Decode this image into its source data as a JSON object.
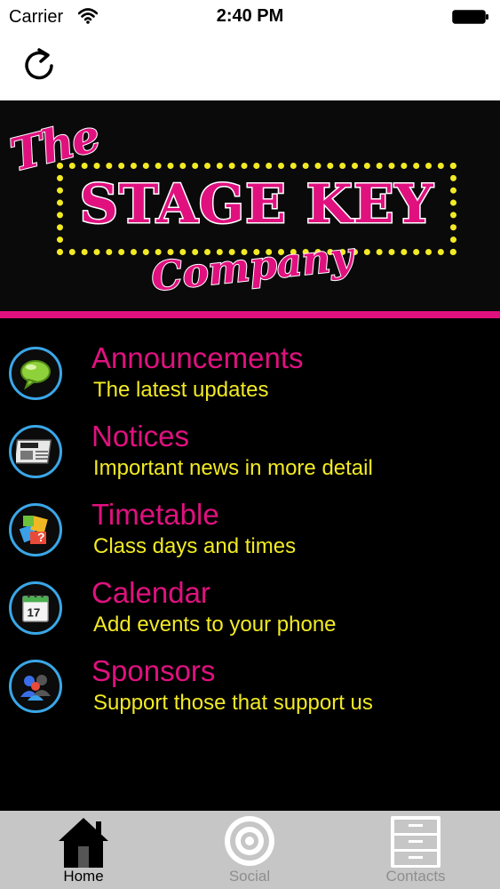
{
  "status_bar": {
    "carrier": "Carrier",
    "time": "2:40 PM"
  },
  "nav_bar": {
    "refresh_icon": "refresh-icon"
  },
  "banner": {
    "logo_the": "The",
    "logo_main": "STAGE KEY",
    "logo_company": "Company"
  },
  "menu": {
    "items": [
      {
        "title": "Announcements",
        "subtitle": "The latest updates",
        "icon": "speech-bubble-icon"
      },
      {
        "title": "Notices",
        "subtitle": "Important news in more detail",
        "icon": "newspaper-icon"
      },
      {
        "title": "Timetable",
        "subtitle": "Class days and times",
        "icon": "puzzle-question-icon"
      },
      {
        "title": "Calendar",
        "subtitle": "Add events to your phone",
        "icon": "calendar-icon"
      },
      {
        "title": "Sponsors",
        "subtitle": "Support those that support us",
        "icon": "people-icon"
      }
    ]
  },
  "tab_bar": {
    "tabs": [
      {
        "label": "Home",
        "icon": "home-icon",
        "active": true
      },
      {
        "label": "Social",
        "icon": "target-icon",
        "active": false
      },
      {
        "label": "Contacts",
        "icon": "file-cabinet-icon",
        "active": false
      }
    ]
  },
  "colors": {
    "accent_pink": "#e0117f",
    "accent_yellow": "#f2ea24",
    "icon_ring_blue": "#3aa7e8",
    "tab_bar_bg": "#c6c6c6"
  }
}
